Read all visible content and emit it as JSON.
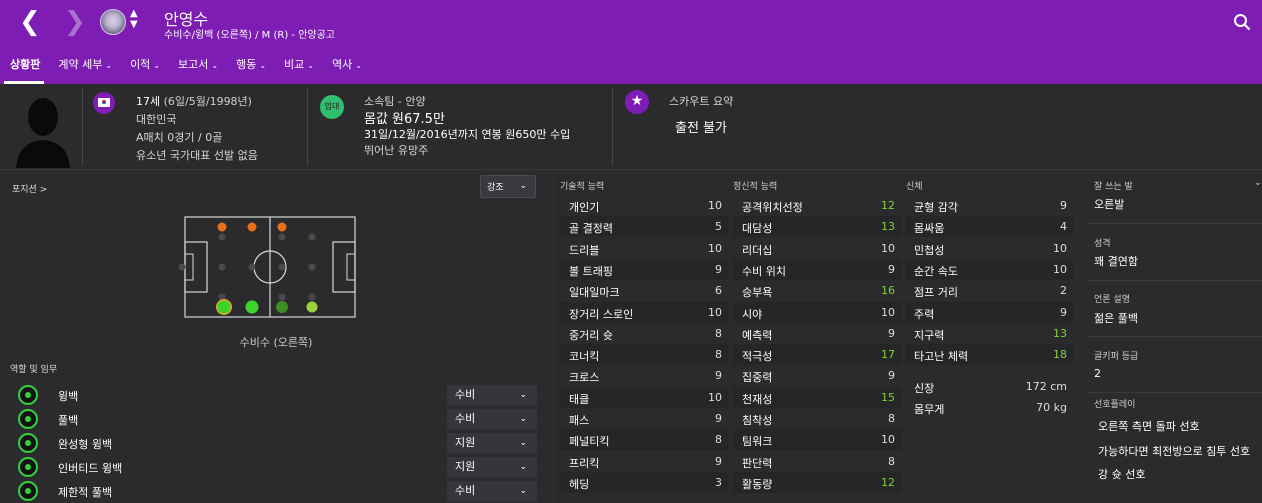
{
  "header": {
    "title": "안영수",
    "subtitle": "수비수/윙백 (오른쪽) / M (R) - 안양공고",
    "back_icon": "chevron-left",
    "forward_icon": "chevron-right",
    "switch_icon": "up-down-arrows",
    "search_icon": "search",
    "accent_color": "#7d1db4"
  },
  "tabs": [
    {
      "label": "상황판"
    },
    {
      "label": "계약 세부"
    },
    {
      "label": "이적"
    },
    {
      "label": "보고서"
    },
    {
      "label": "행동"
    },
    {
      "label": "비교"
    },
    {
      "label": "역사"
    }
  ],
  "info": {
    "age_line": "17세",
    "dob": "(6일/5월/1998년)",
    "nationality": "대한민국",
    "caps": "A매치 0경기 / 0골",
    "youth": "유소년 국가대표 선발 없음",
    "loan_badge": "임대",
    "club": "소속팀 - 안양",
    "value": "몸값 원67.5만",
    "contract": "31일/12월/2016년까지 연봉 원650만 수입",
    "reputation": "뛰어난 유망주",
    "scout_title": "스카우트 요약",
    "scout_status": "출전 불가"
  },
  "positions": {
    "label": "포지션",
    "emphasis": "강조",
    "caption": "수비수 (오른쪽)"
  },
  "roles": {
    "label": "역할 및 임무",
    "items": [
      {
        "name": "윙백",
        "duty": "수비"
      },
      {
        "name": "풀백",
        "duty": "수비"
      },
      {
        "name": "완성형 윙백",
        "duty": "지원"
      },
      {
        "name": "인버티드 윙백",
        "duty": "지원"
      },
      {
        "name": "제한적 풀백",
        "duty": "수비"
      }
    ]
  },
  "attributes": {
    "technical": {
      "title": "기술적 능력",
      "items": [
        {
          "name": "개인기",
          "value": "10"
        },
        {
          "name": "골 결정력",
          "value": "5"
        },
        {
          "name": "드리블",
          "value": "10"
        },
        {
          "name": "볼 트래핑",
          "value": "9"
        },
        {
          "name": "일대일마크",
          "value": "6"
        },
        {
          "name": "장거리 스로인",
          "value": "10"
        },
        {
          "name": "중거리 슛",
          "value": "8"
        },
        {
          "name": "코너킥",
          "value": "8"
        },
        {
          "name": "크로스",
          "value": "9"
        },
        {
          "name": "태클",
          "value": "10"
        },
        {
          "name": "패스",
          "value": "9"
        },
        {
          "name": "페널티킥",
          "value": "8"
        },
        {
          "name": "프리킥",
          "value": "9"
        },
        {
          "name": "헤딩",
          "value": "3"
        }
      ]
    },
    "mental": {
      "title": "정신적 능력",
      "items": [
        {
          "name": "공격위치선정",
          "value": "12"
        },
        {
          "name": "대담성",
          "value": "13"
        },
        {
          "name": "리더십",
          "value": "10"
        },
        {
          "name": "수비 위치",
          "value": "9"
        },
        {
          "name": "승부욕",
          "value": "16"
        },
        {
          "name": "시야",
          "value": "10"
        },
        {
          "name": "예측력",
          "value": "9"
        },
        {
          "name": "적극성",
          "value": "17"
        },
        {
          "name": "집중력",
          "value": "9"
        },
        {
          "name": "천재성",
          "value": "15"
        },
        {
          "name": "침착성",
          "value": "8"
        },
        {
          "name": "팀워크",
          "value": "10"
        },
        {
          "name": "판단력",
          "value": "8"
        },
        {
          "name": "활동량",
          "value": "12"
        }
      ]
    },
    "physical": {
      "title": "신체",
      "items": [
        {
          "name": "균형 감각",
          "value": "9"
        },
        {
          "name": "몸싸움",
          "value": "4"
        },
        {
          "name": "민첩성",
          "value": "10"
        },
        {
          "name": "순간 속도",
          "value": "10"
        },
        {
          "name": "점프 거리",
          "value": "2"
        },
        {
          "name": "주력",
          "value": "9"
        },
        {
          "name": "지구력",
          "value": "13"
        },
        {
          "name": "타고난 체력",
          "value": "18"
        }
      ],
      "height_label": "신장",
      "height_value": "172 cm",
      "weight_label": "몸무게",
      "weight_value": "70 kg"
    }
  },
  "profile": {
    "foot_label": "잘 쓰는 발",
    "foot_value": "오른발",
    "personality_label": "성격",
    "personality_value": "꽤 결연함",
    "media_label": "언론 설명",
    "media_value": "젊은 풀백",
    "gk_label": "골키퍼 등급",
    "gk_value": "2",
    "prefs_label": "선호플레이",
    "prefs": [
      "오른쪽 측면 돌파 선호",
      "가능하다면 최전방으로 침투 선호",
      "강 슛 선호"
    ]
  }
}
